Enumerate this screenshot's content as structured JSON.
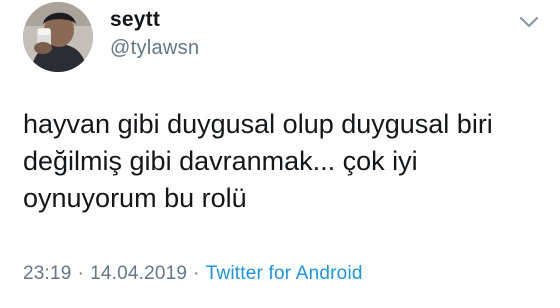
{
  "tweet": {
    "author": {
      "display_name": "seytt",
      "handle": "@tylawsn"
    },
    "text_lines": [
      "hayvan gibi duygusal olup duygusal biri",
      "değilmiş gibi davranmak... çok iyi",
      "oynuyorum bu rolü"
    ],
    "time": "23:19",
    "separator": "·",
    "date": "14.04.2019",
    "source": "Twitter for Android",
    "icons": {
      "avatar": "profile-photo",
      "menu": "chevron-down-icon"
    },
    "colors": {
      "text": "#14171a",
      "secondary": "#657786",
      "link": "#1b95e0"
    }
  }
}
